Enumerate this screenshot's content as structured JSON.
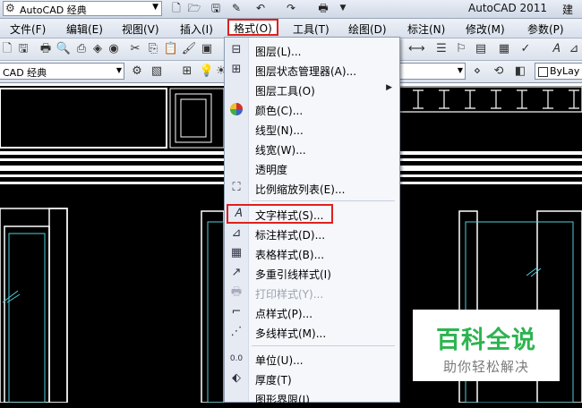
{
  "titlebar": {
    "workspace": "AutoCAD 经典",
    "app_title": "AutoCAD 2011",
    "doc_title": "建筑",
    "quick_access": [
      "new-icon",
      "open-icon",
      "save-icon",
      "saveas-icon",
      "undo-icon",
      "redo-icon",
      "plot-icon",
      "customize-icon"
    ]
  },
  "menubar": {
    "items": [
      "文件(F)",
      "编辑(E)",
      "视图(V)",
      "插入(I)",
      "格式(O)",
      "工具(T)",
      "绘图(D)",
      "标注(N)",
      "修改(M)",
      "参数(P)"
    ],
    "active": "格式(O)"
  },
  "toolbar2": {
    "workspace_combo": "CAD 经典",
    "linetype": "ByLay"
  },
  "format_menu": {
    "items": [
      {
        "label": "图层(L)...",
        "icon": "layer-icon",
        "enabled": true,
        "submenu": false
      },
      {
        "label": "图层状态管理器(A)...",
        "icon": "layer-state-icon",
        "enabled": true,
        "submenu": false
      },
      {
        "label": "图层工具(O)",
        "icon": "",
        "enabled": true,
        "submenu": true
      },
      {
        "label": "颜色(C)...",
        "icon": "color-wheel-icon",
        "enabled": true,
        "submenu": false
      },
      {
        "label": "线型(N)...",
        "icon": "",
        "enabled": true,
        "submenu": false
      },
      {
        "label": "线宽(W)...",
        "icon": "",
        "enabled": true,
        "submenu": false
      },
      {
        "label": "透明度",
        "icon": "",
        "enabled": true,
        "submenu": false
      },
      {
        "label": "比例缩放列表(E)...",
        "icon": "scale-list-icon",
        "enabled": true,
        "submenu": false
      },
      {
        "label": "文字样式(S)...",
        "icon": "text-style-icon",
        "enabled": true,
        "submenu": false,
        "highlighted": true
      },
      {
        "label": "标注样式(D)...",
        "icon": "dim-style-icon",
        "enabled": true,
        "submenu": false
      },
      {
        "label": "表格样式(B)...",
        "icon": "table-style-icon",
        "enabled": true,
        "submenu": false
      },
      {
        "label": "多重引线样式(I)",
        "icon": "mleader-style-icon",
        "enabled": true,
        "submenu": false
      },
      {
        "label": "打印样式(Y)...",
        "icon": "plot-style-icon",
        "enabled": false,
        "submenu": false
      },
      {
        "label": "点样式(P)...",
        "icon": "point-style-icon",
        "enabled": true,
        "submenu": false
      },
      {
        "label": "多线样式(M)...",
        "icon": "mline-style-icon",
        "enabled": true,
        "submenu": false
      },
      {
        "label": "单位(U)...",
        "icon": "units-icon",
        "enabled": true,
        "submenu": false
      },
      {
        "label": "厚度(T)",
        "icon": "thickness-icon",
        "enabled": true,
        "submenu": false
      },
      {
        "label": "图形界限(I)",
        "icon": "",
        "enabled": true,
        "submenu": false
      }
    ]
  },
  "watermark": {
    "title": "百科全说",
    "subtitle": "助你轻松解决"
  },
  "colors": {
    "highlight_box": "#e0201c",
    "cad_lines": "#ffffff",
    "cad_cyan": "#4fd0e0",
    "watermark_green": "#2db450"
  }
}
